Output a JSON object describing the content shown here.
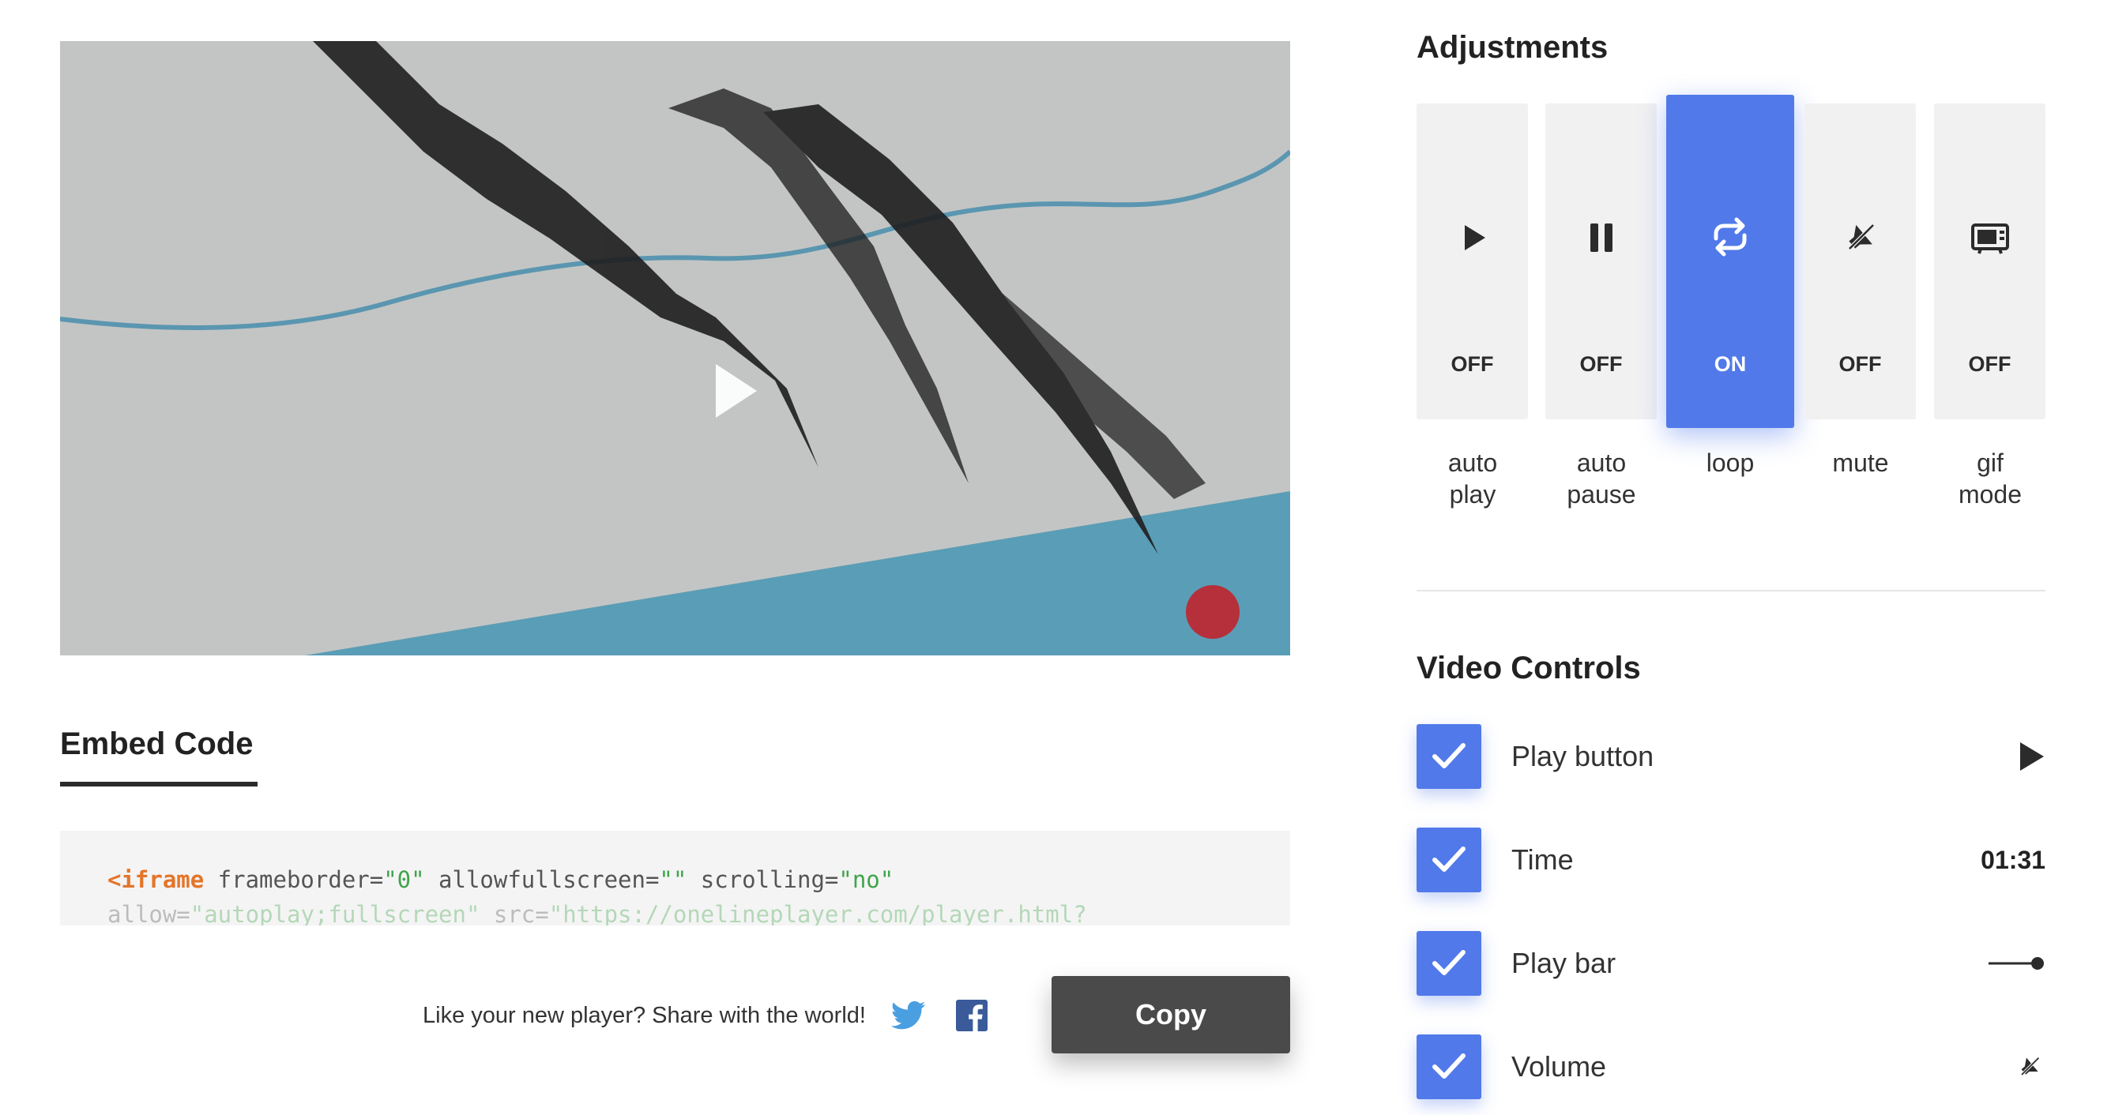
{
  "video": {
    "play_icon": "play-icon"
  },
  "embed": {
    "title": "Embed Code",
    "code_line1": {
      "tag": "<iframe",
      "a1": " frameborder=",
      "v1": "\"0\"",
      "a2": " allowfullscreen=",
      "v2": "\"\"",
      "a3": " scrolling=",
      "v3": "\"no\""
    },
    "code_line2": {
      "a1": "allow=",
      "v1": "\"autoplay;fullscreen\"",
      "a2": " src=",
      "v2": "\"https://onelineplayer.com/player.html?"
    }
  },
  "share": {
    "text": "Like your new player?  Share with the world!",
    "twitter_icon": "twitter-icon",
    "facebook_icon": "facebook-icon"
  },
  "copy_label": "Copy",
  "adjustments": {
    "title": "Adjustments",
    "accent": "#5179ea",
    "items": [
      {
        "label_1": "auto",
        "label_2": "play",
        "state": "OFF",
        "icon": "play-icon"
      },
      {
        "label_1": "auto",
        "label_2": "pause",
        "state": "OFF",
        "icon": "pause-icon"
      },
      {
        "label_1": "loop",
        "label_2": "",
        "state": "ON",
        "icon": "loop-icon"
      },
      {
        "label_1": "mute",
        "label_2": "",
        "state": "OFF",
        "icon": "mute-icon"
      },
      {
        "label_1": "gif",
        "label_2": "mode",
        "state": "OFF",
        "icon": "gif-tv-icon"
      }
    ]
  },
  "video_controls": {
    "title": "Video Controls",
    "items": [
      {
        "label": "Play button",
        "checked": true,
        "preview": "play-icon"
      },
      {
        "label": "Time",
        "checked": true,
        "preview": "01:31"
      },
      {
        "label": "Play bar",
        "checked": true,
        "preview": "play-bar-icon"
      },
      {
        "label": "Volume",
        "checked": true,
        "preview": "volume-icon"
      }
    ]
  }
}
